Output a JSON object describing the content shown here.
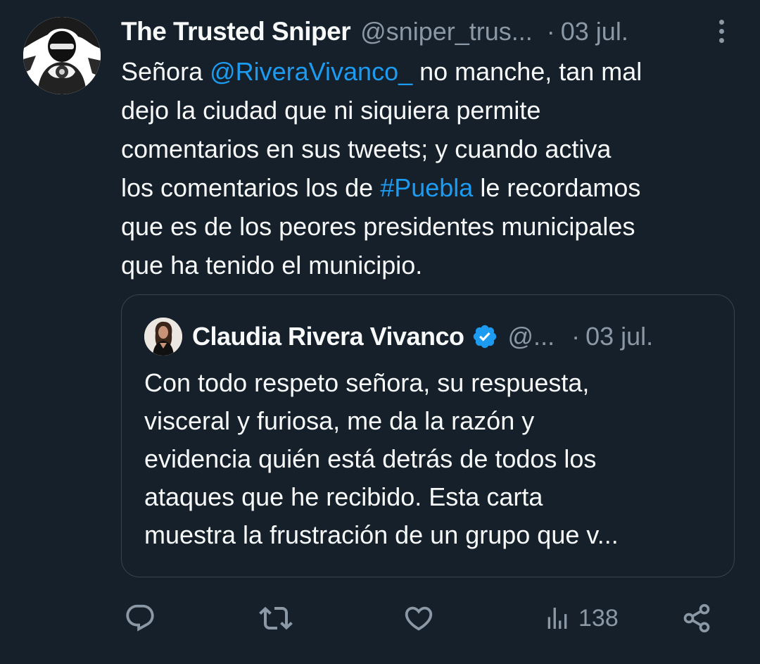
{
  "tweet": {
    "display_name": "The Trusted Sniper",
    "handle": "@sniper_trus...",
    "separator": "·",
    "date": "03 jul.",
    "avatar_icon": "masked-person-avatar",
    "more_icon": "more-vertical-icon",
    "body_lines": [
      [
        {
          "text": "Señora ",
          "type": "text"
        },
        {
          "text": "@RiveraVivanco_",
          "type": "mention"
        },
        {
          "text": " no manche, tan mal",
          "type": "text"
        }
      ],
      [
        {
          "text": "dejo la ciudad que ni siquiera permite",
          "type": "text"
        }
      ],
      [
        {
          "text": "comentarios en sus tweets; y cuando activa",
          "type": "text"
        }
      ],
      [
        {
          "text": "los comentarios los de ",
          "type": "text"
        },
        {
          "text": "#Puebla",
          "type": "hashtag"
        },
        {
          "text": " le recordamos",
          "type": "text"
        }
      ],
      [
        {
          "text": "que es de los peores presidentes municipales",
          "type": "text"
        }
      ],
      [
        {
          "text": "que ha tenido el municipio.",
          "type": "text"
        }
      ]
    ]
  },
  "quote": {
    "display_name": "Claudia Rivera Vivanco",
    "verified": true,
    "handle": "@...",
    "separator": "·",
    "date": "03 jul.",
    "lines": [
      "Con todo respeto señora, su respuesta,",
      "visceral y furiosa, me da la razón y",
      "evidencia quién está detrás de todos los",
      "ataques que he recibido. Esta carta",
      "muestra la frustración de un grupo que v..."
    ]
  },
  "actions": {
    "reply_icon": "reply-icon",
    "retweet_icon": "retweet-icon",
    "like_icon": "like-icon",
    "views_icon": "views-icon",
    "views_count": "138",
    "share_icon": "share-icon"
  },
  "colors": {
    "background": "#15202b",
    "text": "#f7f9f9",
    "secondary": "#8b98a5",
    "link": "#1d9bf0",
    "border": "#38444d"
  }
}
